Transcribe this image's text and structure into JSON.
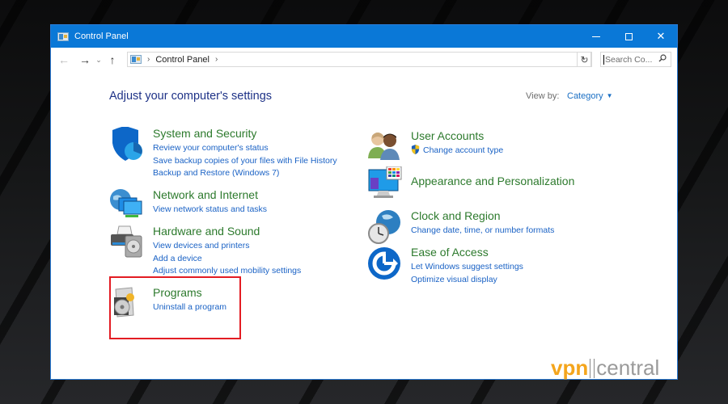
{
  "window": {
    "title": "Control Panel",
    "controls": {
      "minimize": "minimize",
      "maximize": "maximize",
      "close": "✕"
    }
  },
  "navigation": {
    "back": "←",
    "forward": "→",
    "recent": "⌄",
    "up": "↑",
    "breadcrumb": [
      "Control Panel"
    ],
    "separator": "›",
    "dropdown": "⌄",
    "refresh": "↻",
    "search_placeholder": "Search Co...",
    "search_icon": "⚲"
  },
  "main": {
    "heading": "Adjust your computer's settings",
    "view_by_label": "View by:",
    "view_by_value": "Category",
    "view_by_arrow": "▼"
  },
  "categories_left": [
    {
      "title": "System and Security",
      "icon": "shield-icon",
      "links": [
        "Review your computer's status",
        "Save backup copies of your files with File History",
        "Backup and Restore (Windows 7)"
      ]
    },
    {
      "title": "Network and Internet",
      "icon": "network-icon",
      "links": [
        "View network status and tasks"
      ]
    },
    {
      "title": "Hardware and Sound",
      "icon": "printer-icon",
      "links": [
        "View devices and printers",
        "Add a device",
        "Adjust commonly used mobility settings"
      ]
    },
    {
      "title": "Programs",
      "icon": "programs-icon",
      "links": [
        "Uninstall a program"
      ],
      "highlighted": true
    }
  ],
  "categories_right": [
    {
      "title": "User Accounts",
      "icon": "users-icon",
      "links": [
        "Change account type"
      ]
    },
    {
      "title": "Appearance and Personalization",
      "icon": "appearance-icon",
      "links": []
    },
    {
      "title": "Clock and Region",
      "icon": "clock-globe-icon",
      "links": [
        "Change date, time, or number formats"
      ]
    },
    {
      "title": "Ease of Access",
      "icon": "ease-of-access-icon",
      "links": [
        "Let Windows suggest settings",
        "Optimize visual display"
      ]
    }
  ],
  "colors": {
    "titlebar": "#0a78d7",
    "heading": "#1e3287",
    "category_title": "#2d7a2d",
    "link": "#1a62c5",
    "highlight": "#e31c23"
  },
  "watermark": {
    "left": "vpn",
    "right": "central"
  }
}
